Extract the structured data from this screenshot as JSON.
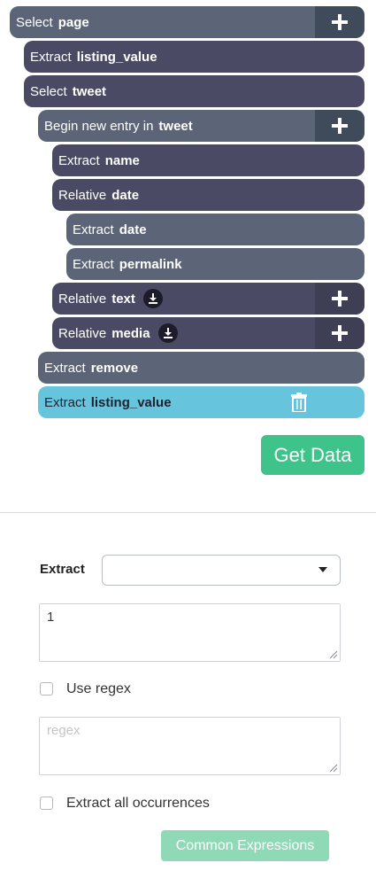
{
  "commands": [
    {
      "verb": "Select",
      "target": "page"
    },
    {
      "verb": "Extract",
      "target": "listing_value"
    },
    {
      "verb": "Select",
      "target": "tweet"
    },
    {
      "verb": "Begin new entry in",
      "target": "tweet"
    },
    {
      "verb": "Extract",
      "target": "name"
    },
    {
      "verb": "Relative",
      "target": "date"
    },
    {
      "verb": "Extract",
      "target": "date"
    },
    {
      "verb": "Extract",
      "target": "permalink"
    },
    {
      "verb": "Relative",
      "target": "text"
    },
    {
      "verb": "Relative",
      "target": "media"
    },
    {
      "verb": "Extract",
      "target": "remove"
    },
    {
      "verb": "Extract",
      "target": "listing_value"
    }
  ],
  "get_data_label": "Get Data",
  "panel": {
    "extract_label": "Extract",
    "extract_select_value": "",
    "attribute_value": "1",
    "use_regex_label": "Use regex",
    "regex_placeholder": "regex",
    "extract_all_label": "Extract all occurrences",
    "common_expressions_label": "Common Expressions"
  }
}
